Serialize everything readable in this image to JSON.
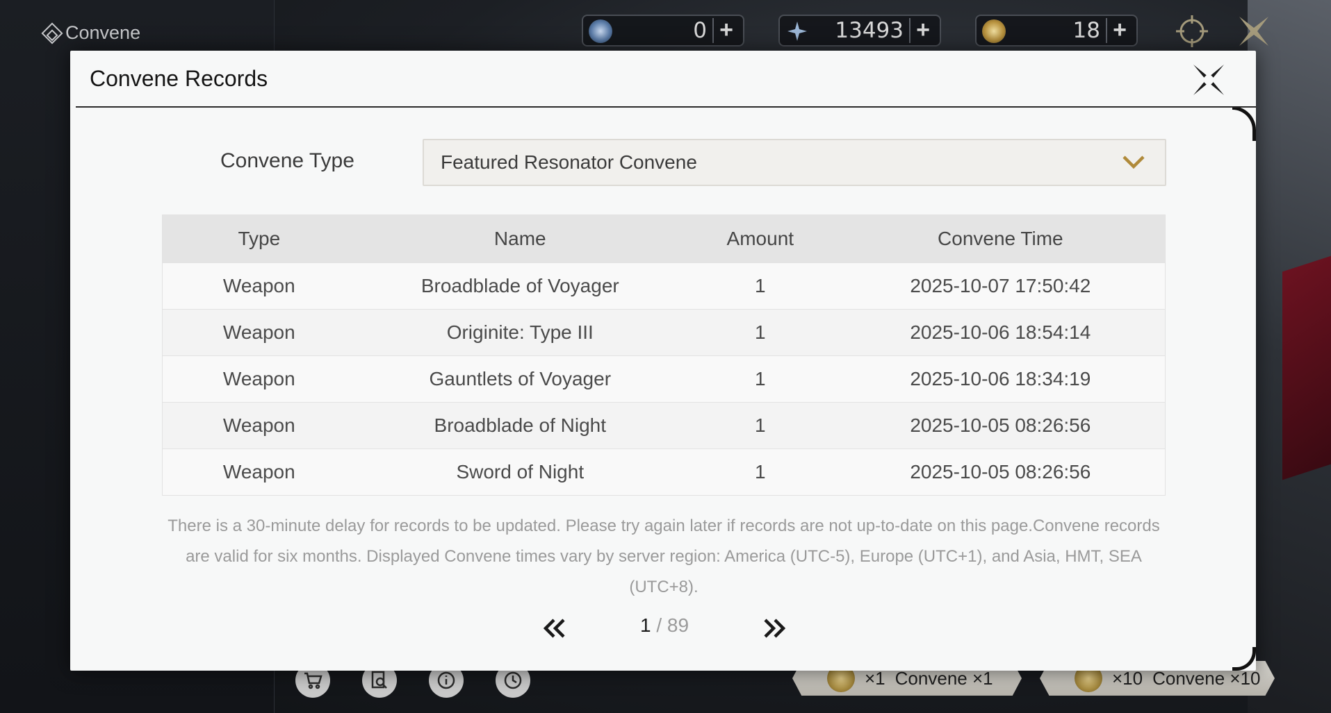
{
  "app": {
    "title": "Convene"
  },
  "currencies": [
    {
      "icon": "astrite-icon",
      "value": "0",
      "color": "#6c8fb8"
    },
    {
      "icon": "lunite-icon",
      "value": "13493",
      "color": "#9bb6d6"
    },
    {
      "icon": "radiant-tide-icon",
      "value": "18",
      "color": "#c8a64e"
    }
  ],
  "modal": {
    "title": "Convene Records",
    "filter_label": "Convene Type",
    "filter_value": "Featured Resonator Convene",
    "columns": [
      "Type",
      "Name",
      "Amount",
      "Convene Time"
    ],
    "rows": [
      {
        "type": "Weapon",
        "name": "Broadblade of Voyager",
        "amount": "1",
        "time": "2025-10-07 17:50:42"
      },
      {
        "type": "Weapon",
        "name": "Originite: Type III",
        "amount": "1",
        "time": "2025-10-06 18:54:14"
      },
      {
        "type": "Weapon",
        "name": "Gauntlets of Voyager",
        "amount": "1",
        "time": "2025-10-06 18:34:19"
      },
      {
        "type": "Weapon",
        "name": "Broadblade of Night",
        "amount": "1",
        "time": "2025-10-05 08:26:56"
      },
      {
        "type": "Weapon",
        "name": "Sword of Night",
        "amount": "1",
        "time": "2025-10-05 08:26:56"
      }
    ],
    "notice": "There is a 30-minute delay for records to be updated. Please try again later if records are not up-to-date on this page.Convene records are valid for six months. Displayed Convene times vary by server region: America (UTC-5), Europe (UTC+1), and Asia, HMT, SEA (UTC+8).",
    "pagination": {
      "current": "1",
      "separator": "/",
      "total": "89"
    }
  },
  "bottom_bar": {
    "convene_single_count": "×1",
    "convene_single_label": "Convene ×1",
    "convene_multi_count": "×10",
    "convene_multi_label": "Convene ×10"
  },
  "colors": {
    "modal_bg": "#f7f8f8",
    "accent_gold": "#b08a3a",
    "header_rule": "#2a2a2a"
  }
}
